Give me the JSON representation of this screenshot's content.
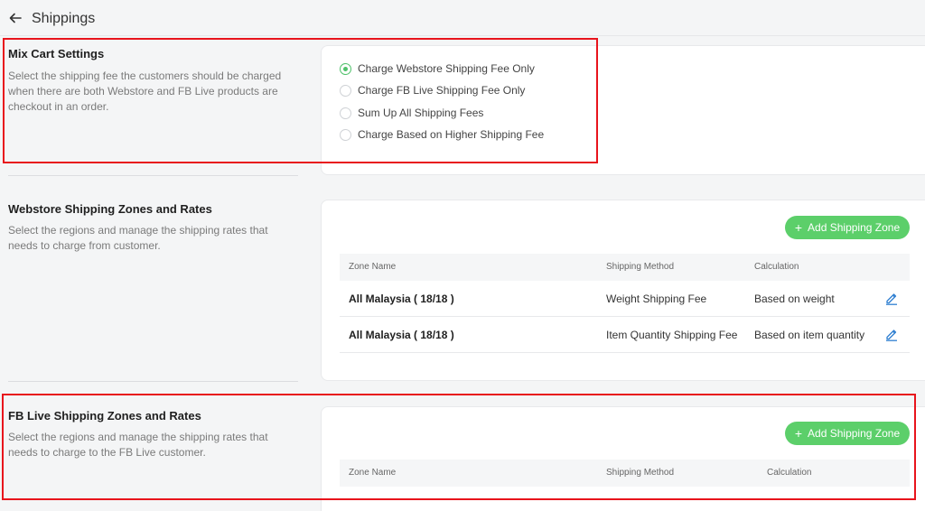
{
  "header": {
    "title": "Shippings"
  },
  "mix_cart": {
    "title": "Mix Cart Settings",
    "description": "Select the shipping fee the customers should be charged when there are both Webstore and FB Live products are checkout in an order.",
    "options": [
      {
        "label": "Charge Webstore Shipping Fee Only",
        "checked": true
      },
      {
        "label": "Charge FB Live Shipping Fee Only",
        "checked": false
      },
      {
        "label": "Sum Up All Shipping Fees",
        "checked": false
      },
      {
        "label": "Charge Based on Higher Shipping Fee",
        "checked": false
      }
    ]
  },
  "webstore": {
    "title": "Webstore Shipping Zones and Rates",
    "description": "Select the regions and manage the shipping rates that needs to charge from customer.",
    "add_label": "Add Shipping Zone",
    "columns": [
      "Zone Name",
      "Shipping Method",
      "Calculation"
    ],
    "rows": [
      {
        "zone": "All Malaysia ( 18/18 )",
        "method": "Weight Shipping Fee",
        "calculation": "Based on weight"
      },
      {
        "zone": "All Malaysia ( 18/18 )",
        "method": "Item Quantity Shipping Fee",
        "calculation": "Based on item quantity"
      }
    ]
  },
  "fblive": {
    "title": "FB Live Shipping Zones and Rates",
    "description": "Select the regions and manage the shipping rates that needs to charge to the FB Live customer.",
    "add_label": "Add Shipping Zone",
    "columns": [
      "Zone Name",
      "Shipping Method",
      "Calculation"
    ]
  },
  "colors": {
    "accent": "#5ccf6a",
    "highlight": "#e8141c",
    "edit": "#2f7fd1"
  }
}
